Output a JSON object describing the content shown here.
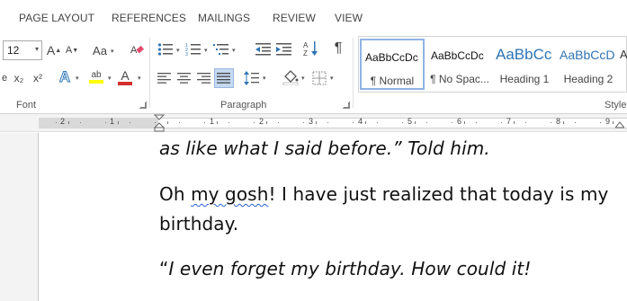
{
  "tabs": [
    "PAGE LAYOUT",
    "REFERENCES",
    "MAILINGS",
    "REVIEW",
    "VIEW"
  ],
  "font_group": {
    "font_size": "12",
    "grow_label": "A",
    "shrink_label": "A",
    "case_label": "Aa",
    "subscript": "x₂",
    "superscript": "x²",
    "text_effects": "A",
    "highlight_label": "ab",
    "font_color_label": "A",
    "label": "Font"
  },
  "paragraph_group": {
    "label": "Paragraph",
    "pilcrow": "¶"
  },
  "styles_group": {
    "label": "Style",
    "items": [
      {
        "sample": "AaBbCcDc",
        "name": "¶ Normal"
      },
      {
        "sample": "AaBbCcDc",
        "name": "¶ No Spac..."
      },
      {
        "sample": "AaBbCc",
        "name": "Heading 1"
      },
      {
        "sample": "AaBbCcD",
        "name": "Heading 2"
      }
    ],
    "partial": "A"
  },
  "ruler": {
    "numbers": [
      "2",
      "1",
      "1",
      "2",
      "3",
      "4",
      "5",
      "6",
      "7",
      "8",
      "9"
    ]
  },
  "document": {
    "line1": "as like what I said before.” Told him.",
    "line2_a": "Oh ",
    "line2_b": "my gosh",
    "line2_c": "! I have just realized that today is my",
    "line3": "birthday.",
    "line4_quote": "“",
    "line4": "I even forget my birthday. How could it!"
  }
}
